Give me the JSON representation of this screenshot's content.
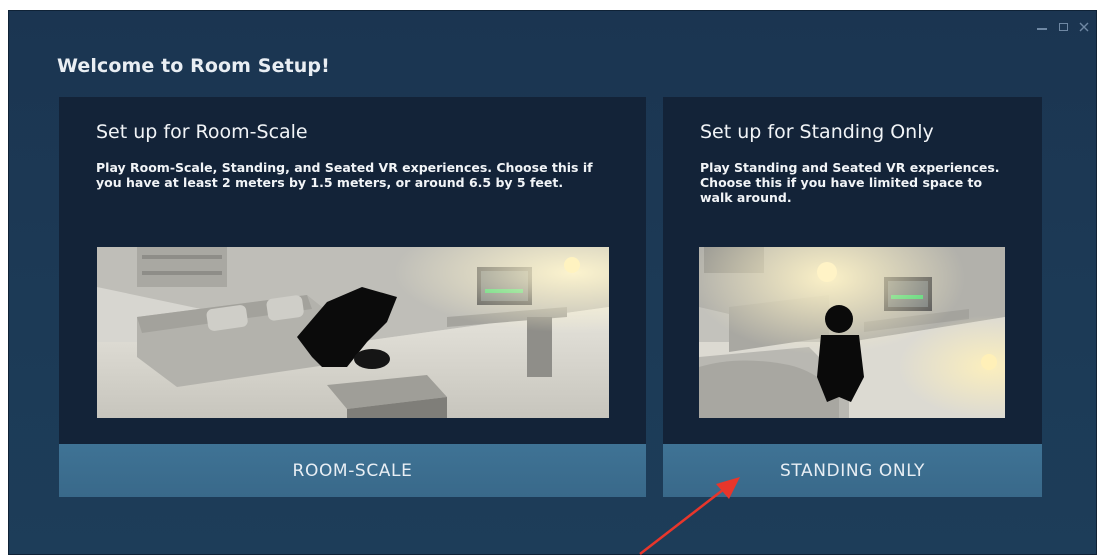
{
  "window": {
    "title": "Welcome to Room Setup!",
    "controls": [
      "minimize-icon",
      "maximize-icon",
      "close-icon"
    ]
  },
  "options": [
    {
      "heading": "Set up for Room-Scale",
      "description": "Play Room-Scale, Standing, and Seated VR experiences. Choose this if you have at least 2 meters by 1.5 meters, or around 6.5 by 5 feet.",
      "button_label": "ROOM-SCALE"
    },
    {
      "heading": "Set up for Standing Only",
      "description": "Play Standing and Seated VR experiences. Choose this if you have limited space to walk around.",
      "button_label": "STANDING ONLY"
    }
  ],
  "colors": {
    "window_bg": "#1b3551",
    "card_bg": "#132338",
    "button_bg": "#3f7395",
    "text": "#f1f4f7",
    "annotation_arrow": "#e8362b"
  }
}
